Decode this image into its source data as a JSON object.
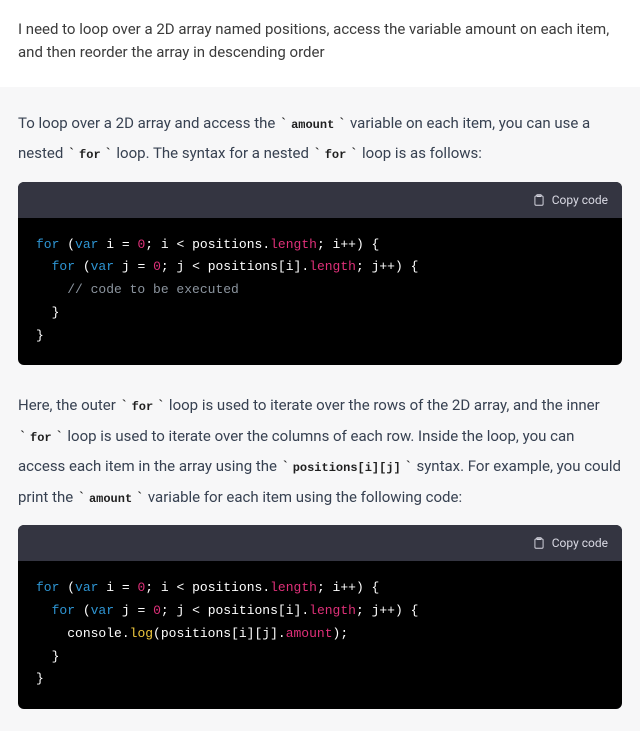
{
  "user": {
    "prompt": "I need to loop over a 2D array named positions, access the variable amount on each item, and then reorder the array in descending order"
  },
  "assistant": {
    "para1_a": "To loop over a 2D array and access the ",
    "para1_code1": "amount",
    "para1_b": " variable on each item, you can use a nested ",
    "para1_code2": "for",
    "para1_c": " loop. The syntax for a nested ",
    "para1_code3": "for",
    "para1_d": " loop is as follows:",
    "para2_a": "Here, the outer ",
    "para2_code1": "for",
    "para2_b": " loop is used to iterate over the rows of the 2D array, and the inner ",
    "para2_code2": "for",
    "para2_c": " loop is used to iterate over the columns of each row. Inside the loop, you can access each item in the array using the ",
    "para2_code3": "positions[i][j]",
    "para2_d": " syntax. For example, you could print the ",
    "para2_code4": "amount",
    "para2_e": " variable for each item using the following code:"
  },
  "code": {
    "copy_label": "Copy code",
    "kw_for": "for",
    "kw_var": "var",
    "id_i": "i",
    "id_j": "j",
    "eq": " = ",
    "zero": "0",
    "semi": "; ",
    "lt": " < ",
    "positions": "positions",
    "dot": ".",
    "length": "length",
    "ipp": "i++",
    "jpp": "j++",
    "pos_i": "positions[i]",
    "pos_ij": "positions[i][j]",
    "amount": "amount",
    "open": ") {",
    "close": "}",
    "lparen": " (",
    "lparen2": "(",
    "rparen_semi": ");",
    "comment": "// code to be executed",
    "console": "console",
    "log": "log"
  }
}
